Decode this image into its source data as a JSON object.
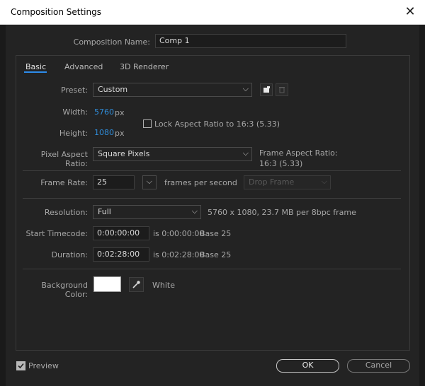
{
  "window": {
    "title": "Composition Settings",
    "close_glyph": "✕"
  },
  "composition_name": {
    "label": "Composition Name:",
    "value": "Comp 1"
  },
  "tabs": [
    {
      "label": "Basic",
      "active": true
    },
    {
      "label": "Advanced",
      "active": false
    },
    {
      "label": "3D Renderer",
      "active": false
    }
  ],
  "preset": {
    "label": "Preset:",
    "value": "Custom",
    "save_icon": "save-preset-icon",
    "delete_icon": "trash-icon"
  },
  "width": {
    "label": "Width:",
    "value": "5760",
    "unit": "px"
  },
  "height": {
    "label": "Height:",
    "value": "1080",
    "unit": "px"
  },
  "lock_aspect": {
    "label": "Lock Aspect Ratio to 16:3 (5.33)",
    "checked": false
  },
  "pixel_aspect": {
    "label": "Pixel Aspect Ratio:",
    "value": "Square Pixels"
  },
  "frame_aspect": {
    "label": "Frame Aspect Ratio:",
    "value": "16:3 (5.33)"
  },
  "frame_rate": {
    "label": "Frame Rate:",
    "value": "25",
    "unit": "frames per second",
    "drop_frame": "Drop Frame"
  },
  "resolution": {
    "label": "Resolution:",
    "value": "Full",
    "info": "5760 x 1080, 23.7 MB per 8bpc frame"
  },
  "start_timecode": {
    "label": "Start Timecode:",
    "value": "0:00:00:00",
    "equiv": "is 0:00:00:00",
    "base": "Base 25"
  },
  "duration": {
    "label": "Duration:",
    "value": "0:02:28:00",
    "equiv": "is 0:02:28:00",
    "base": "Base 25"
  },
  "background": {
    "label": "Background Color:",
    "color": "#ffffff",
    "name": "White",
    "eyedropper_icon": "eyedropper-icon"
  },
  "preview": {
    "label": "Preview",
    "checked": true
  },
  "buttons": {
    "ok": "OK",
    "cancel": "Cancel"
  },
  "colors": {
    "accent": "#2d8ceb",
    "value_blue": "#2f8cd8",
    "background": "#232323"
  }
}
